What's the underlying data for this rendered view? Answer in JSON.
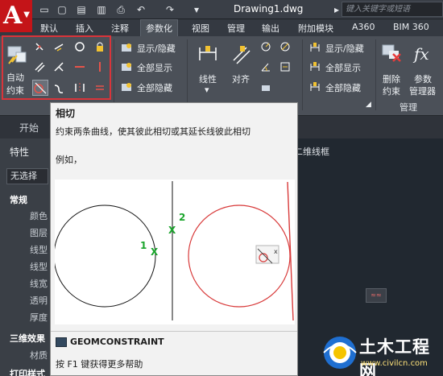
{
  "titlebar": {
    "app_logo": "A",
    "doc_title": "Drawing1.dwg",
    "search_placeholder": "键入关键字或短语"
  },
  "tabs": [
    "默认",
    "插入",
    "注释",
    "参数化",
    "视图",
    "管理",
    "输出",
    "附加模块",
    "A360",
    "BIM 360"
  ],
  "active_tab": "参数化",
  "ribbon": {
    "auto_constrain": "自动\n约束",
    "auto_line1": "自动",
    "auto_line2": "约束",
    "geom_show_hide": "显示/隐藏",
    "geom_show_all": "全部显示",
    "geom_hide_all": "全部隐藏",
    "linear": "线性",
    "aligned": "对齐",
    "dim_show_hide": "显示/隐藏",
    "dim_show_all": "全部显示",
    "dim_hide_all": "全部隐藏",
    "delete_line1": "删除",
    "delete_line2": "约束",
    "params_line1": "参数",
    "params_line2": "管理器",
    "manage_label": "管理",
    "dropdown_arrow": "▾"
  },
  "doc_tabs": {
    "start": "开始"
  },
  "properties": {
    "header": "特性",
    "selection": "无选择",
    "general": "常规",
    "rows": [
      "颜色",
      "图层",
      "线型",
      "线型",
      "线宽",
      "透明",
      "厚度"
    ],
    "three_d": "三维效果",
    "material": "材质",
    "print": "打印样式"
  },
  "model": {
    "wireframe": "二维线框"
  },
  "tooltip": {
    "title": "相切",
    "description": "约束两条曲线，使其彼此相切或其延长线彼此相切",
    "example": "例如，",
    "label_1": "1",
    "label_2": "2",
    "marker": "X",
    "command": "GEOMCONSTRAINT",
    "help": "按 F1 键获得更多帮助"
  },
  "watermark": {
    "site": "土木工程网",
    "url": "www.civilcn.com"
  },
  "colors": {
    "accent_red": "#d9343a",
    "ribbon_bg": "#4b5058",
    "tooltip_bg": "#f2f2f2"
  }
}
